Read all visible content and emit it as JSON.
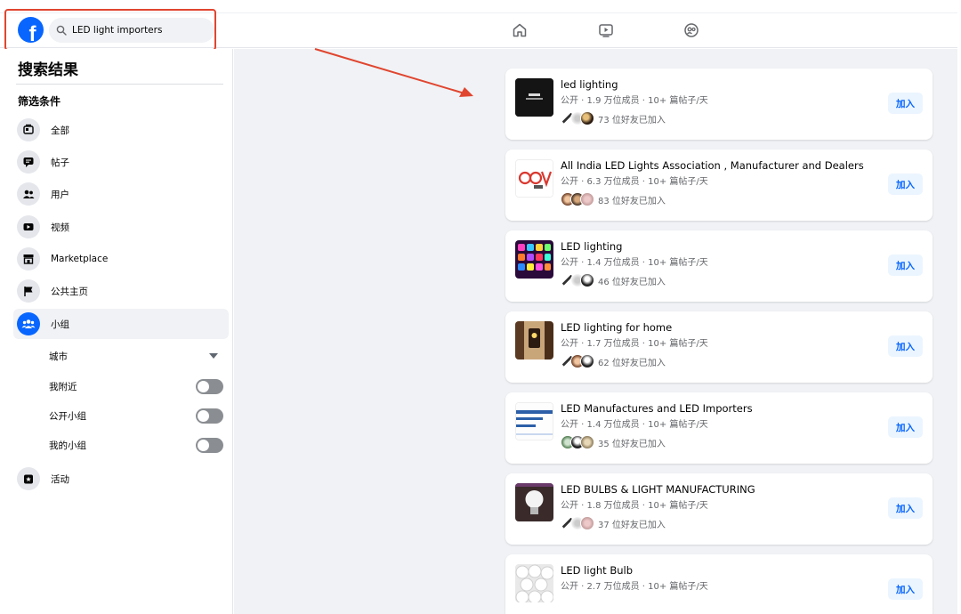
{
  "search": {
    "value": "LED light importers"
  },
  "colors": {
    "brand": "#0866ff",
    "annotation": "#e0452f"
  },
  "nav": {
    "icons": [
      "home-icon",
      "watch-icon",
      "profile-icon"
    ]
  },
  "sidebar": {
    "title": "搜索结果",
    "filter_heading": "筛选条件",
    "items": [
      {
        "label": "全部",
        "icon": "all-results-icon"
      },
      {
        "label": "帖子",
        "icon": "posts-icon"
      },
      {
        "label": "用户",
        "icon": "people-icon"
      },
      {
        "label": "视频",
        "icon": "video-icon"
      },
      {
        "label": "Marketplace",
        "icon": "marketplace-icon"
      },
      {
        "label": "公共主页",
        "icon": "pages-flag-icon"
      },
      {
        "label": "小组",
        "icon": "groups-icon",
        "active": true
      },
      {
        "label": "活动",
        "icon": "events-star-icon"
      }
    ],
    "group_filters": [
      {
        "label": "城市",
        "control": "dropdown"
      },
      {
        "label": "我附近",
        "control": "toggle",
        "on": false
      },
      {
        "label": "公开小组",
        "control": "toggle",
        "on": false
      },
      {
        "label": "我的小组",
        "control": "toggle",
        "on": false
      }
    ]
  },
  "results": [
    {
      "name": "led lighting",
      "meta": "公开 · 1.9 万位成员 · 10+ 篇帖子/天",
      "friends": "73 位好友已加入",
      "join": "加入"
    },
    {
      "name": "All India LED Lights Association , Manufacturer and Dealers",
      "meta": "公开 · 6.3 万位成员 · 10+ 篇帖子/天",
      "friends": "83 位好友已加入",
      "join": "加入"
    },
    {
      "name": "LED lighting",
      "meta": "公开 · 1.4 万位成员 · 10+ 篇帖子/天",
      "friends": "46 位好友已加入",
      "join": "加入"
    },
    {
      "name": "LED lighting for home",
      "meta": "公开 · 1.7 万位成员 · 10+ 篇帖子/天",
      "friends": "62 位好友已加入",
      "join": "加入"
    },
    {
      "name": "LED Manufactures and LED Importers",
      "meta": "公开 · 1.4 万位成员 · 10+ 篇帖子/天",
      "friends": "35 位好友已加入",
      "join": "加入"
    },
    {
      "name": "LED BULBS & LIGHT MANUFACTURING",
      "meta": "公开 · 1.8 万位成员 · 10+ 篇帖子/天",
      "friends": "37 位好友已加入",
      "join": "加入"
    },
    {
      "name": "LED light Bulb",
      "meta": "公开 · 2.7 万位成员 · 10+ 篇帖子/天",
      "friends": "",
      "join": "加入"
    }
  ]
}
